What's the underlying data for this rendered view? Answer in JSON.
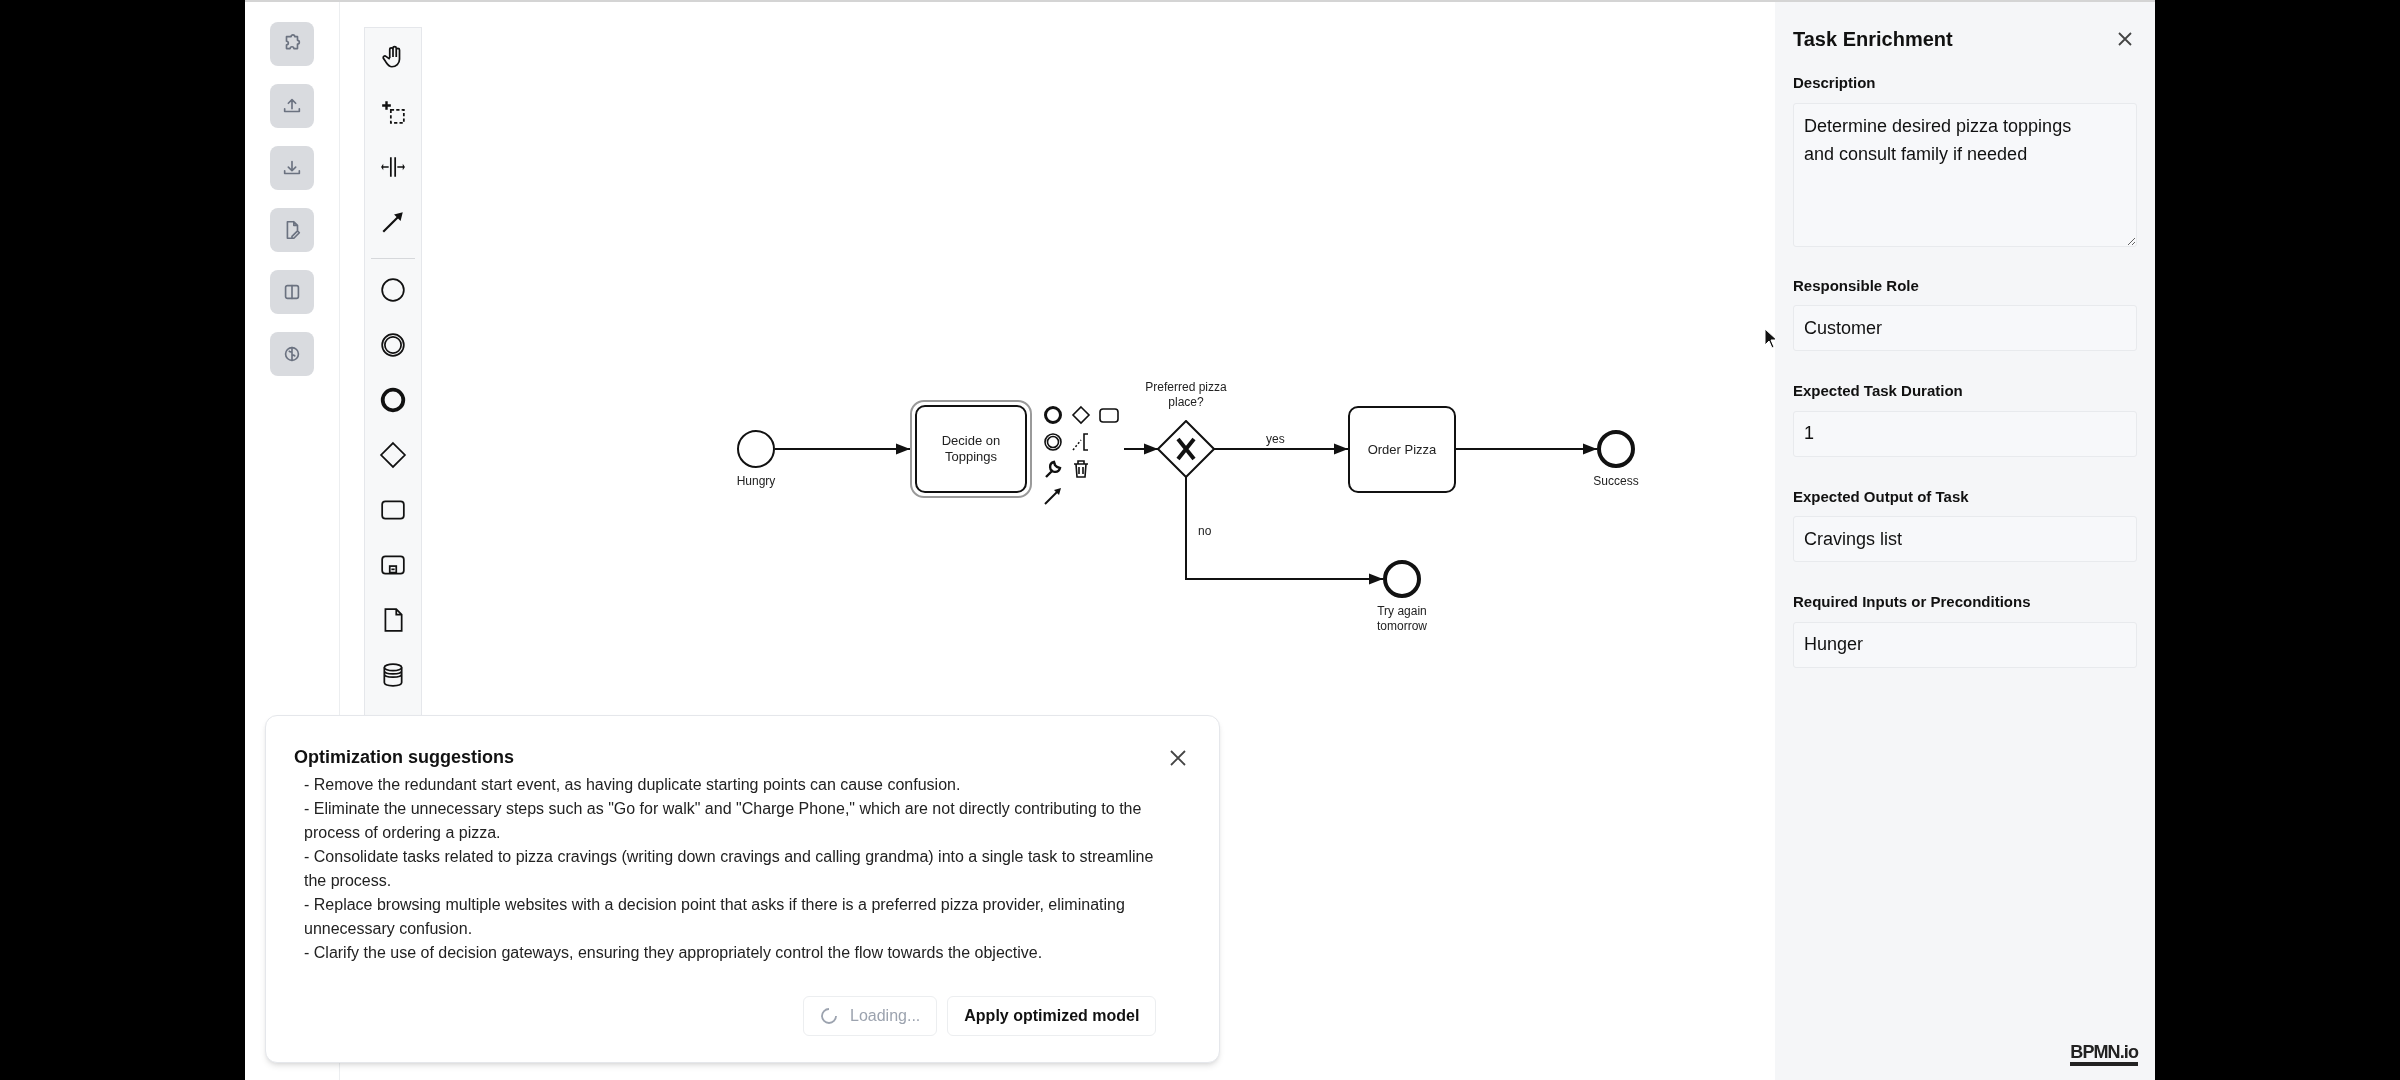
{
  "diagram": {
    "nodes": [
      {
        "kind": "start_event",
        "label": "Hungry",
        "selected": false
      },
      {
        "kind": "task",
        "label": "Decide on Toppings",
        "selected": true
      },
      {
        "kind": "gateway",
        "label": "Preferred pizza place?",
        "selected": false
      },
      {
        "kind": "task",
        "label": "Order Pizza",
        "selected": false
      },
      {
        "kind": "end_event",
        "label": "Success",
        "selected": false
      },
      {
        "kind": "end_event",
        "label": "Try again tomorrow",
        "selected": false
      }
    ],
    "branch_labels": [
      "yes",
      "no"
    ]
  },
  "panel": {
    "title": "Task Enrichment",
    "fields": [
      {
        "kind": "textarea",
        "label": "Description",
        "value": "Determine desired pizza toppings and consult family if needed"
      },
      {
        "kind": "input",
        "label": "Responsible Role",
        "value": "Customer"
      },
      {
        "kind": "input",
        "label": "Expected Task Duration",
        "value": "1"
      },
      {
        "kind": "input",
        "label": "Expected Output of Task",
        "value": "Cravings list"
      },
      {
        "kind": "input",
        "label": "Required Inputs or Preconditions",
        "value": "Hunger"
      }
    ]
  },
  "dialog": {
    "title": "Optimization suggestions",
    "suggestions": [
      "- Remove the redundant start event, as having duplicate starting points can cause confusion.",
      "- Eliminate the unnecessary steps such as \"Go for walk\" and \"Charge Phone,\" which are not directly contributing to the process of ordering a pizza.",
      "- Consolidate tasks related to pizza cravings (writing down cravings and calling grandma) into a single task to streamline the process.",
      "- Replace browsing multiple websites with a decision point that asks if there is a preferred pizza provider, eliminating unnecessary confusion.",
      "- Clarify the use of decision gateways, ensuring they appropriately control the flow towards the objective."
    ],
    "buttons": [
      {
        "kind": "loading",
        "label": "Loading...",
        "disabled": true
      },
      {
        "kind": "primary",
        "label": "Apply optimized model",
        "disabled": false
      }
    ]
  },
  "logo": "BPMN.io"
}
